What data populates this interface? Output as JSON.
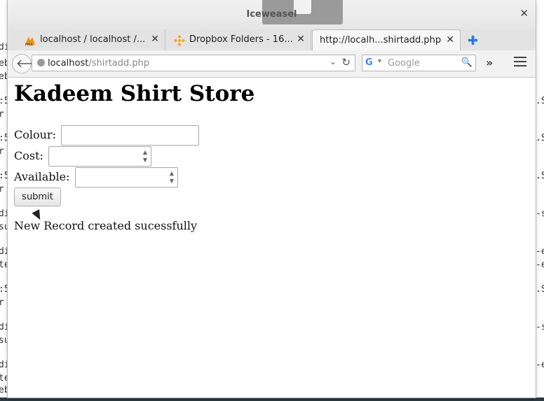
{
  "background_terminal": {
    "left_lines": [
      "di",
      "eb",
      "eb",
      ":5",
      "r",
      ":5",
      "r",
      ":5",
      "r",
      "di",
      "su",
      "di",
      "te",
      ":5",
      "r",
      "di",
      "su",
      "di",
      "te",
      "eb"
    ],
    "right_lines": [
      ".S",
      ".S",
      ".S",
      "-s",
      "-e",
      "-e",
      ".S",
      "-s",
      "-e"
    ]
  },
  "window": {
    "title": "Iceweasel"
  },
  "tabs": [
    {
      "label": "localhost / localhost /...",
      "icon": "phpmyadmin-icon"
    },
    {
      "label": "Dropbox Folders - 16...",
      "icon": "dropbox-icon"
    },
    {
      "label": "http://localh...shirtadd.php",
      "icon": ""
    }
  ],
  "navbar": {
    "url_host": "localhost",
    "url_path": "/shirtadd.php",
    "search_placeholder": "Google"
  },
  "page": {
    "heading": "Kadeem Shirt Store",
    "form": {
      "colour_label": "Colour:",
      "colour_value": "",
      "cost_label": "Cost:",
      "cost_value": "",
      "available_label": "Available:",
      "available_value": "",
      "submit_label": "submit"
    },
    "status_message": "New Record created sucessfully"
  },
  "colors": {
    "accent": "#2c7be5",
    "pma_orange": "#f29111",
    "dropbox": "#f5a623"
  }
}
